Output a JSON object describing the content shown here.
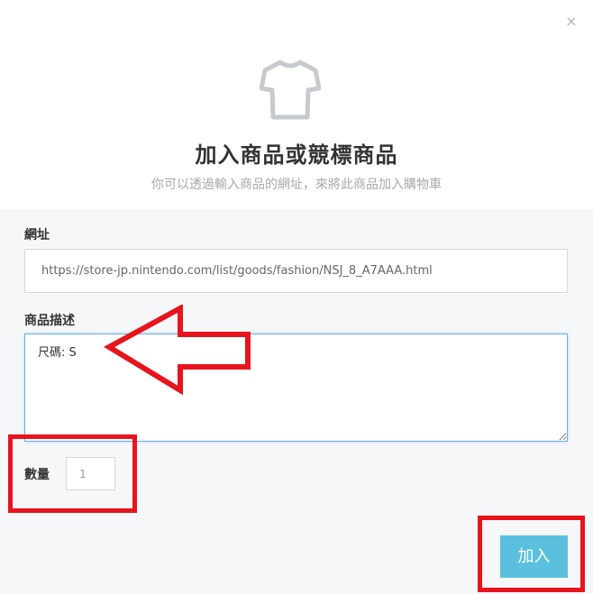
{
  "dialog": {
    "close_symbol": "×",
    "icon": "tshirt-icon",
    "title": "加入商品或競標商品",
    "subtitle": "你可以透過輸入商品的網址，來將此商品加入購物車"
  },
  "form": {
    "url_label": "網址",
    "url_value": "https://store-jp.nintendo.com/list/goods/fashion/NSJ_8_A7AAA.html",
    "description_label": "商品描述",
    "description_value": "尺碼: S",
    "quantity_label": "數量",
    "quantity_value": "1",
    "submit_label": "加入"
  },
  "annotations": {
    "highlight_color": "#e8141d",
    "arrow_icon": "left-arrow-outline-icon"
  },
  "colors": {
    "accent": "#5bc0de",
    "focus_border": "#66afe9"
  }
}
